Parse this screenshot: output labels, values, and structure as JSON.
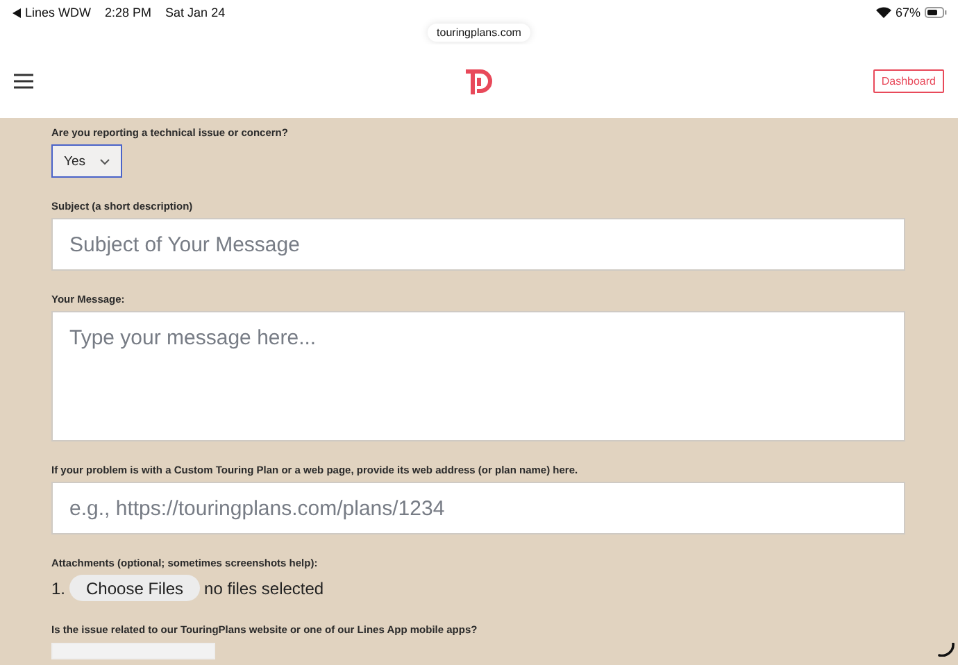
{
  "status_bar": {
    "back_label": "Lines WDW",
    "time": "2:28 PM",
    "date": "Sat Jan 24",
    "battery": "67%"
  },
  "url_bar": {
    "url": "touringplans.com"
  },
  "header": {
    "dashboard_button": "Dashboard"
  },
  "form": {
    "fields": [
      {
        "kind": "select",
        "label": "Are you reporting a technical issue or concern?",
        "value": "Yes"
      },
      {
        "kind": "text",
        "label": "Subject (a short description)",
        "placeholder": "Subject of Your Message"
      },
      {
        "kind": "textarea",
        "label": "Your Message:",
        "placeholder": "Type your message here..."
      },
      {
        "kind": "text",
        "label": "If your problem is with a Custom Touring Plan or a web page, provide its web address (or plan name) here.",
        "placeholder": "e.g., https://touringplans.com/plans/1234"
      },
      {
        "kind": "file",
        "label": "Attachments (optional; sometimes screenshots help):",
        "number": "1.",
        "button": "Choose Files",
        "status": "no files selected"
      },
      {
        "kind": "select",
        "label": "Is the issue related to our TouringPlans website or one of our Lines App mobile apps?"
      }
    ]
  }
}
